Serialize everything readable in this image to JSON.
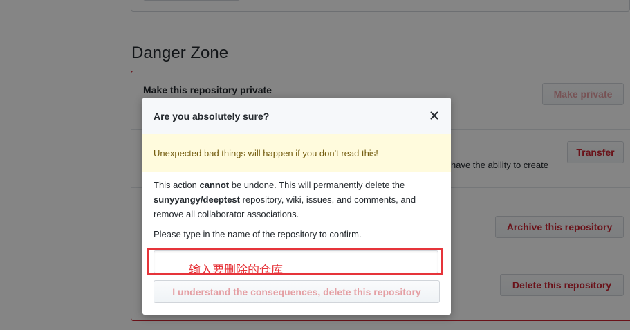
{
  "danger_zone": {
    "title": "Danger Zone",
    "make_private_heading": "Make this repository private",
    "make_private_button": "Make private",
    "transfer_button": "Transfer",
    "transfer_desc_partial": "have the ability to create",
    "archive_button": "Archive this repository",
    "delete_button": "Delete this repository"
  },
  "modal": {
    "title": "Are you absolutely sure?",
    "close_icon": "close-icon",
    "warning": "Unexpected bad things will happen if you don't read this!",
    "body": {
      "part1": "This action ",
      "cannot": "cannot",
      "part2": " be undone. This will permanently delete the ",
      "repo": "sunyyangy/deeptest",
      "part3": " repository, wiki, issues, and comments, and remove all collaborator associations."
    },
    "confirm_label": "Please type in the name of the repository to confirm.",
    "confirm_input_value": "",
    "annotation": "输入要删除的仓库",
    "confirm_button": "I understand the consequences, delete this repository"
  },
  "colors": {
    "danger": "#cb2431",
    "annotation_red": "#e6343a",
    "flash_bg": "#fffbdd"
  }
}
